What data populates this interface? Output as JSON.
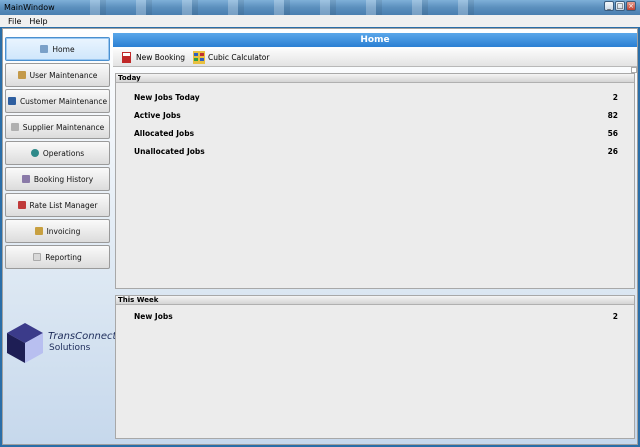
{
  "window": {
    "title": "MainWindow"
  },
  "menu": [
    {
      "label": "File"
    },
    {
      "label": "Help"
    }
  ],
  "sidebar": {
    "items": [
      {
        "label": "Home",
        "icon": "home-icon",
        "color": "#7aa0c8",
        "active": true
      },
      {
        "label": "User Maintenance",
        "icon": "users-icon",
        "color": "#c49a4a"
      },
      {
        "label": "Customer Maintenance",
        "icon": "customer-icon",
        "color": "#2f5fa0"
      },
      {
        "label": "Supplier Maintenance",
        "icon": "supplier-icon",
        "color": "#b0b0b0"
      },
      {
        "label": "Operations",
        "icon": "globe-icon",
        "color": "#2f8a8a"
      },
      {
        "label": "Booking History",
        "icon": "history-icon",
        "color": "#8a7aa8"
      },
      {
        "label": "Rate List Manager",
        "icon": "rate-list-icon",
        "color": "#c03a3a"
      },
      {
        "label": "Invoicing",
        "icon": "invoice-icon",
        "color": "#c8a040"
      },
      {
        "label": "Reporting",
        "icon": "report-icon",
        "color": "#d8d8d8"
      }
    ]
  },
  "logo": {
    "line1": "TransConnect",
    "line2": "Solutions"
  },
  "main": {
    "header": "Home",
    "toolbar": [
      {
        "label": "New Booking",
        "icon": "new-booking-icon"
      },
      {
        "label": "Cubic Calculator",
        "icon": "calculator-icon"
      }
    ],
    "today": {
      "title": "Today",
      "rows": [
        {
          "label": "New Jobs Today",
          "value": "2"
        },
        {
          "label": "Active Jobs",
          "value": "82"
        },
        {
          "label": "Allocated Jobs",
          "value": "56"
        },
        {
          "label": "Unallocated Jobs",
          "value": "26"
        }
      ]
    },
    "week": {
      "title": "This Week",
      "rows": [
        {
          "label": "New Jobs",
          "value": "2"
        }
      ]
    }
  }
}
